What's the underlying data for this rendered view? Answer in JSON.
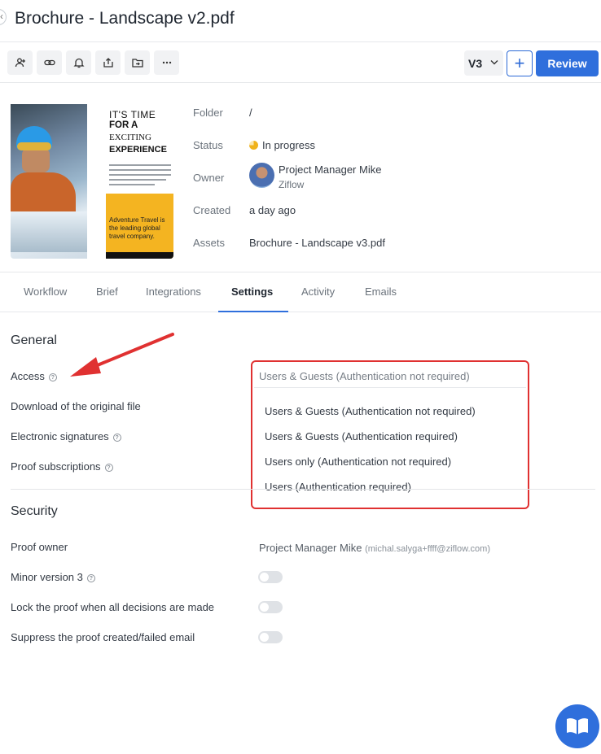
{
  "header": {
    "title": "Brochure - Landscape v2.pdf"
  },
  "toolbar": {
    "icons": [
      "add-user-icon",
      "link-icon",
      "bell-icon",
      "share-icon",
      "move-folder-icon",
      "more-icon"
    ],
    "version": "V3",
    "add_label": "+",
    "review_label": "Review"
  },
  "thumbnail": {
    "line1": "IT'S TIME",
    "line2": "FOR A",
    "line3": "EXCITING",
    "line4": "EXPERIENCE",
    "footer": "Adventure Travel is the leading global travel company."
  },
  "meta": {
    "folder_label": "Folder",
    "folder_value": "/",
    "status_label": "Status",
    "status_value": "In progress",
    "owner_label": "Owner",
    "owner_name": "Project Manager Mike",
    "owner_org": "Ziflow",
    "created_label": "Created",
    "created_value": "a day ago",
    "assets_label": "Assets",
    "assets_value": "Brochure - Landscape v3.pdf"
  },
  "tabs": [
    "Workflow",
    "Brief",
    "Integrations",
    "Settings",
    "Activity",
    "Emails"
  ],
  "active_tab": "Settings",
  "general": {
    "title": "General",
    "access_label": "Access",
    "download_label": "Download of the original file",
    "esign_label": "Electronic signatures",
    "subscriptions_label": "Proof subscriptions"
  },
  "access_dropdown": {
    "selected": "Users & Guests (Authentication not required)",
    "options": [
      "Users & Guests (Authentication not required)",
      "Users & Guests (Authentication required)",
      "Users only (Authentication not required)",
      "Users (Authentication required)"
    ]
  },
  "security": {
    "title": "Security",
    "proof_owner_label": "Proof owner",
    "proof_owner_name": "Project Manager Mike",
    "proof_owner_email": "(michal.salyga+ffff@ziflow.com)",
    "minor_version_label": "Minor version 3",
    "lock_label": "Lock the proof when all decisions are made",
    "suppress_label": "Suppress the proof created/failed email",
    "minor_version_on": false,
    "lock_on": false,
    "suppress_on": false
  },
  "colors": {
    "accent": "#2f6fdc",
    "highlight": "#e03131",
    "status": "#f0b21b"
  }
}
